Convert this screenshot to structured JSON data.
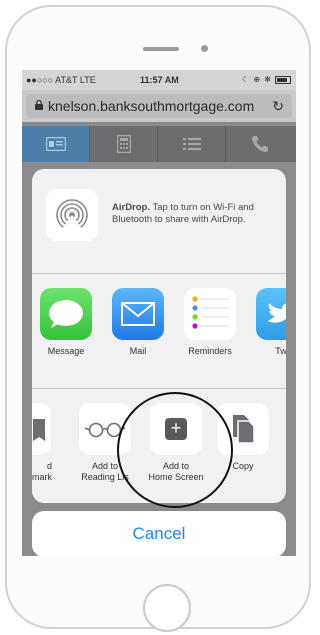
{
  "status_bar": {
    "carrier": "●●○○○ AT&T  LTE",
    "time": "11:57 AM",
    "icons": "☾ ⊕ ✻"
  },
  "browser": {
    "url": "knelson.banksouthmortgage.com",
    "reload_icon": "↻"
  },
  "site_nav": {
    "tabs": [
      {
        "icon": "id-card-icon",
        "active": true
      },
      {
        "icon": "calculator-icon",
        "active": false
      },
      {
        "icon": "list-icon",
        "active": false
      },
      {
        "icon": "phone-icon",
        "active": false
      }
    ]
  },
  "share_sheet": {
    "airdrop": {
      "title": "AirDrop.",
      "text": " Tap to turn on Wi-Fi and Bluetooth to share with AirDrop."
    },
    "apps": [
      {
        "label": "Message",
        "icon": "messages-icon"
      },
      {
        "label": "Mail",
        "icon": "mail-icon"
      },
      {
        "label": "Reminders",
        "icon": "reminders-icon"
      },
      {
        "label": "Twi",
        "icon": "twitter-icon"
      }
    ],
    "actions": [
      {
        "label": "d",
        "label2": "mark",
        "icon": "bookmark-icon"
      },
      {
        "label": "Add to",
        "label2": "Reading Lis",
        "icon": "reading-list-icon"
      },
      {
        "label": "Add to",
        "label2": "Home Screen",
        "icon": "add-to-home-icon"
      },
      {
        "label": "Copy",
        "label2": "",
        "icon": "copy-icon"
      }
    ]
  },
  "cancel_label": "Cancel",
  "colors": {
    "accent": "#1a8cf0",
    "active_tab": "#4d7fa8"
  }
}
